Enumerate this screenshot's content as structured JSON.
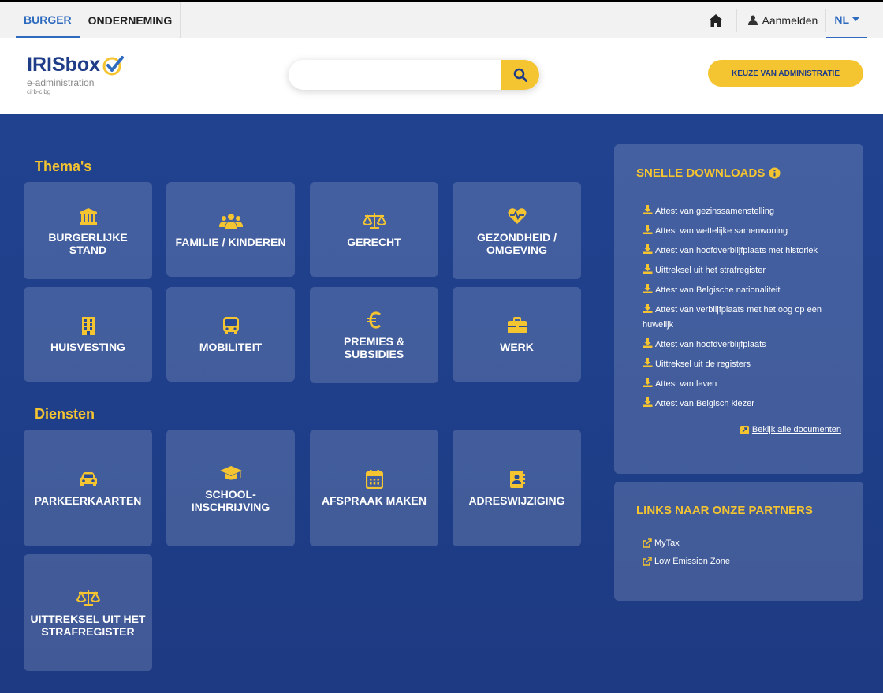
{
  "topbar": {
    "tabs": [
      "BURGER",
      "ONDERNEMING"
    ],
    "login": "Aanmelden",
    "lang": "NL"
  },
  "header": {
    "logo": {
      "brand": "IRISbox",
      "sub": "e-administration",
      "sub2": "cirb-cibg"
    },
    "search": {
      "placeholder": ""
    },
    "choose_admin": "KEUZE VAN ADMINISTRATIE"
  },
  "themes": {
    "title": "Thema's",
    "tiles": [
      {
        "label": "BURGERLIJKE STAND",
        "icon": "bank-icon"
      },
      {
        "label": "FAMILIE / KINDEREN",
        "icon": "family-icon"
      },
      {
        "label": "GERECHT",
        "icon": "scale-icon"
      },
      {
        "label": "GEZONDHEID / OMGEVING",
        "icon": "heart-pulse-icon"
      },
      {
        "label": "HUISVESTING",
        "icon": "building-icon"
      },
      {
        "label": "MOBILITEIT",
        "icon": "bus-icon"
      },
      {
        "label": "PREMIES & SUBSIDIES",
        "icon": "euro-icon"
      },
      {
        "label": "WERK",
        "icon": "briefcase-icon"
      }
    ]
  },
  "services": {
    "title": "Diensten",
    "tiles": [
      {
        "label": "PARKEERKAARTEN",
        "icon": "car-icon"
      },
      {
        "label": "SCHOOL-INSCHRIJVING",
        "icon": "graduation-cap-icon"
      },
      {
        "label": "AFSPRAAK MAKEN",
        "icon": "calendar-icon"
      },
      {
        "label": "ADRESWIJZIGING",
        "icon": "address-book-icon"
      },
      {
        "label": "UITTREKSEL UIT HET STRAFREGISTER",
        "icon": "scale-icon"
      }
    ]
  },
  "downloads": {
    "title": "SNELLE DOWNLOADS",
    "items": [
      "Attest van gezinssamenstelling",
      "Attest van wettelijke samenwoning",
      "Attest van hoofdverblijfplaats met historiek",
      "Uittreksel uit het strafregister",
      "Attest van Belgische nationaliteit",
      "Attest van verblijfplaats met het oog op een huwelijk",
      "Attest van hoofdverblijfplaats",
      "Uittreksel uit de registers",
      "Attest van leven",
      "Attest van Belgisch kiezer"
    ],
    "see_all": "Bekijk alle documenten"
  },
  "partners": {
    "title": "LINKS NAAR ONZE PARTNERS",
    "items": [
      "MyTax",
      "Low Emission Zone"
    ]
  },
  "colors": {
    "accent": "#f5c431",
    "primary": "#1f3c88",
    "tab_active": "#2e6bbf"
  }
}
